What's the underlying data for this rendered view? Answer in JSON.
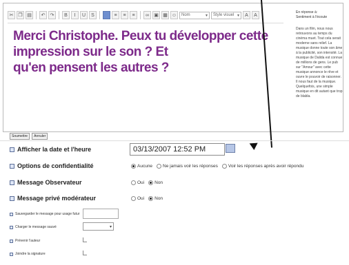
{
  "toolbar": {
    "font_select": "Nom",
    "style_select": "Style visuel"
  },
  "editor": {
    "text_line1": "Merci Christophe. Peux tu développer cette impression sur le son ? Et",
    "text_line2": "qu'en pensent les autres ?"
  },
  "sidebar": {
    "title_line1": "En réponse à:",
    "title_line2": "Sentiment à l'écoute",
    "body": "Dans un film, nous nous retrouvons au temps du cinéma muet. Tout cela serait moderne sans relief. La musique donne toute son âme à la publicité, son intensité. La musique de Dalida est connue de millions de gens. Le pub sur \"Amour\" avec cette musique annonce le rêve et ouvre le pouvoir de raisonner. Il nous faut de la musique. Quelquefois, une simple musique en dit autant que trop de blabla."
  },
  "buttons": {
    "submit": "Soumettre",
    "cancel": "Annuler"
  },
  "fields": {
    "date_label": "Afficher la date et l'heure",
    "date_value": "03/13/2007 12:52 PM",
    "privacy_label": "Options de confidentialité",
    "privacy_options": [
      "Aucune",
      "Ne jamais voir les réponses",
      "Voir les réponses après avoir répondu"
    ],
    "privacy_selected": 0,
    "observer_label": "Message Observateur",
    "observer_options": [
      "Oui",
      "Non"
    ],
    "observer_selected": 1,
    "moderator_label": "Message privé modérateur",
    "moderator_options": [
      "Oui",
      "Non"
    ],
    "moderator_selected": 1,
    "save_label": "Sauvegarder le message pour usage futur",
    "load_label": "Charger le message sauvé",
    "first_author_label": "Prévenir l'auteur",
    "signature_label": "Joindre la signature"
  }
}
